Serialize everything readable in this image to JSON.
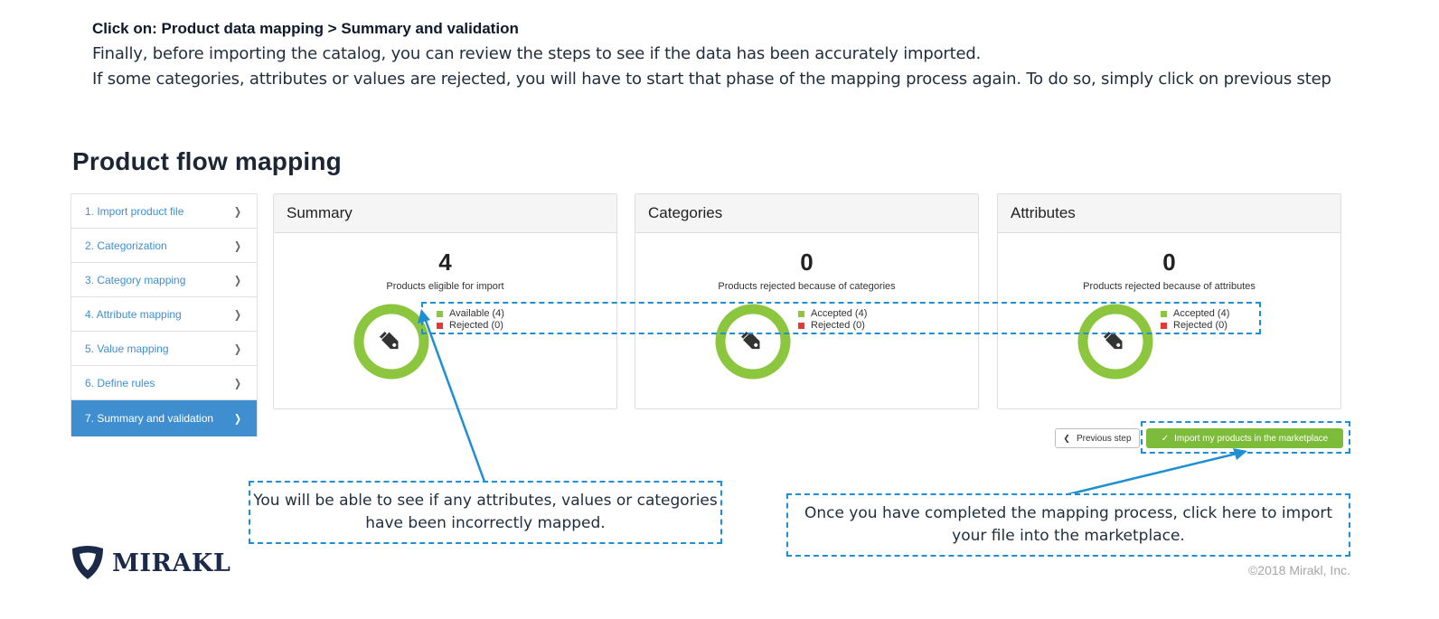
{
  "intro": {
    "heading": "Click on: Product data mapping > Summary and validation",
    "line1": "Finally, before importing the catalog, you can review the steps to see if the data has been accurately imported.",
    "line2": "If some categories, attributes or values are rejected, you will have to start that phase of the mapping process again. To do so, simply click on previous step"
  },
  "page_title": "Product flow mapping",
  "sidebar": {
    "steps": [
      {
        "label": "1. Import product file"
      },
      {
        "label": "2. Categorization"
      },
      {
        "label": "3. Category mapping"
      },
      {
        "label": "4. Attribute mapping"
      },
      {
        "label": "5. Value mapping"
      },
      {
        "label": "6. Define rules"
      },
      {
        "label": "7. Summary and validation",
        "active": true
      }
    ]
  },
  "cards": [
    {
      "title": "Summary",
      "count": "4",
      "subtitle": "Products eligible for import",
      "legend": [
        {
          "label": "Available (4)",
          "color": "#8cc63f"
        },
        {
          "label": "Rejected (0)",
          "color": "#e53935"
        }
      ],
      "ring_fill": 1.0
    },
    {
      "title": "Categories",
      "count": "0",
      "subtitle": "Products rejected because of categories",
      "legend": [
        {
          "label": "Accepted (4)",
          "color": "#8cc63f"
        },
        {
          "label": "Rejected (0)",
          "color": "#e53935"
        }
      ],
      "ring_fill": 1.0
    },
    {
      "title": "Attributes",
      "count": "0",
      "subtitle": "Products rejected because of attributes",
      "legend": [
        {
          "label": "Accepted (4)",
          "color": "#8cc63f"
        },
        {
          "label": "Rejected (0)",
          "color": "#e53935"
        }
      ],
      "ring_fill": 1.0
    }
  ],
  "buttons": {
    "previous": "Previous step",
    "import": "Import my products in the marketplace"
  },
  "callouts": {
    "left": "You will be able to see if any attributes, values or categories have been incorrectly mapped.",
    "right": "Once you have completed the mapping process, click here to import your file into the marketplace."
  },
  "logo": "MIRAKL",
  "copyright": "©2018 Mirakl, Inc.",
  "colors": {
    "accent_blue": "#3e8ed0",
    "callout_blue": "#1e8fd2",
    "green": "#8cc63f",
    "red": "#e53935"
  }
}
